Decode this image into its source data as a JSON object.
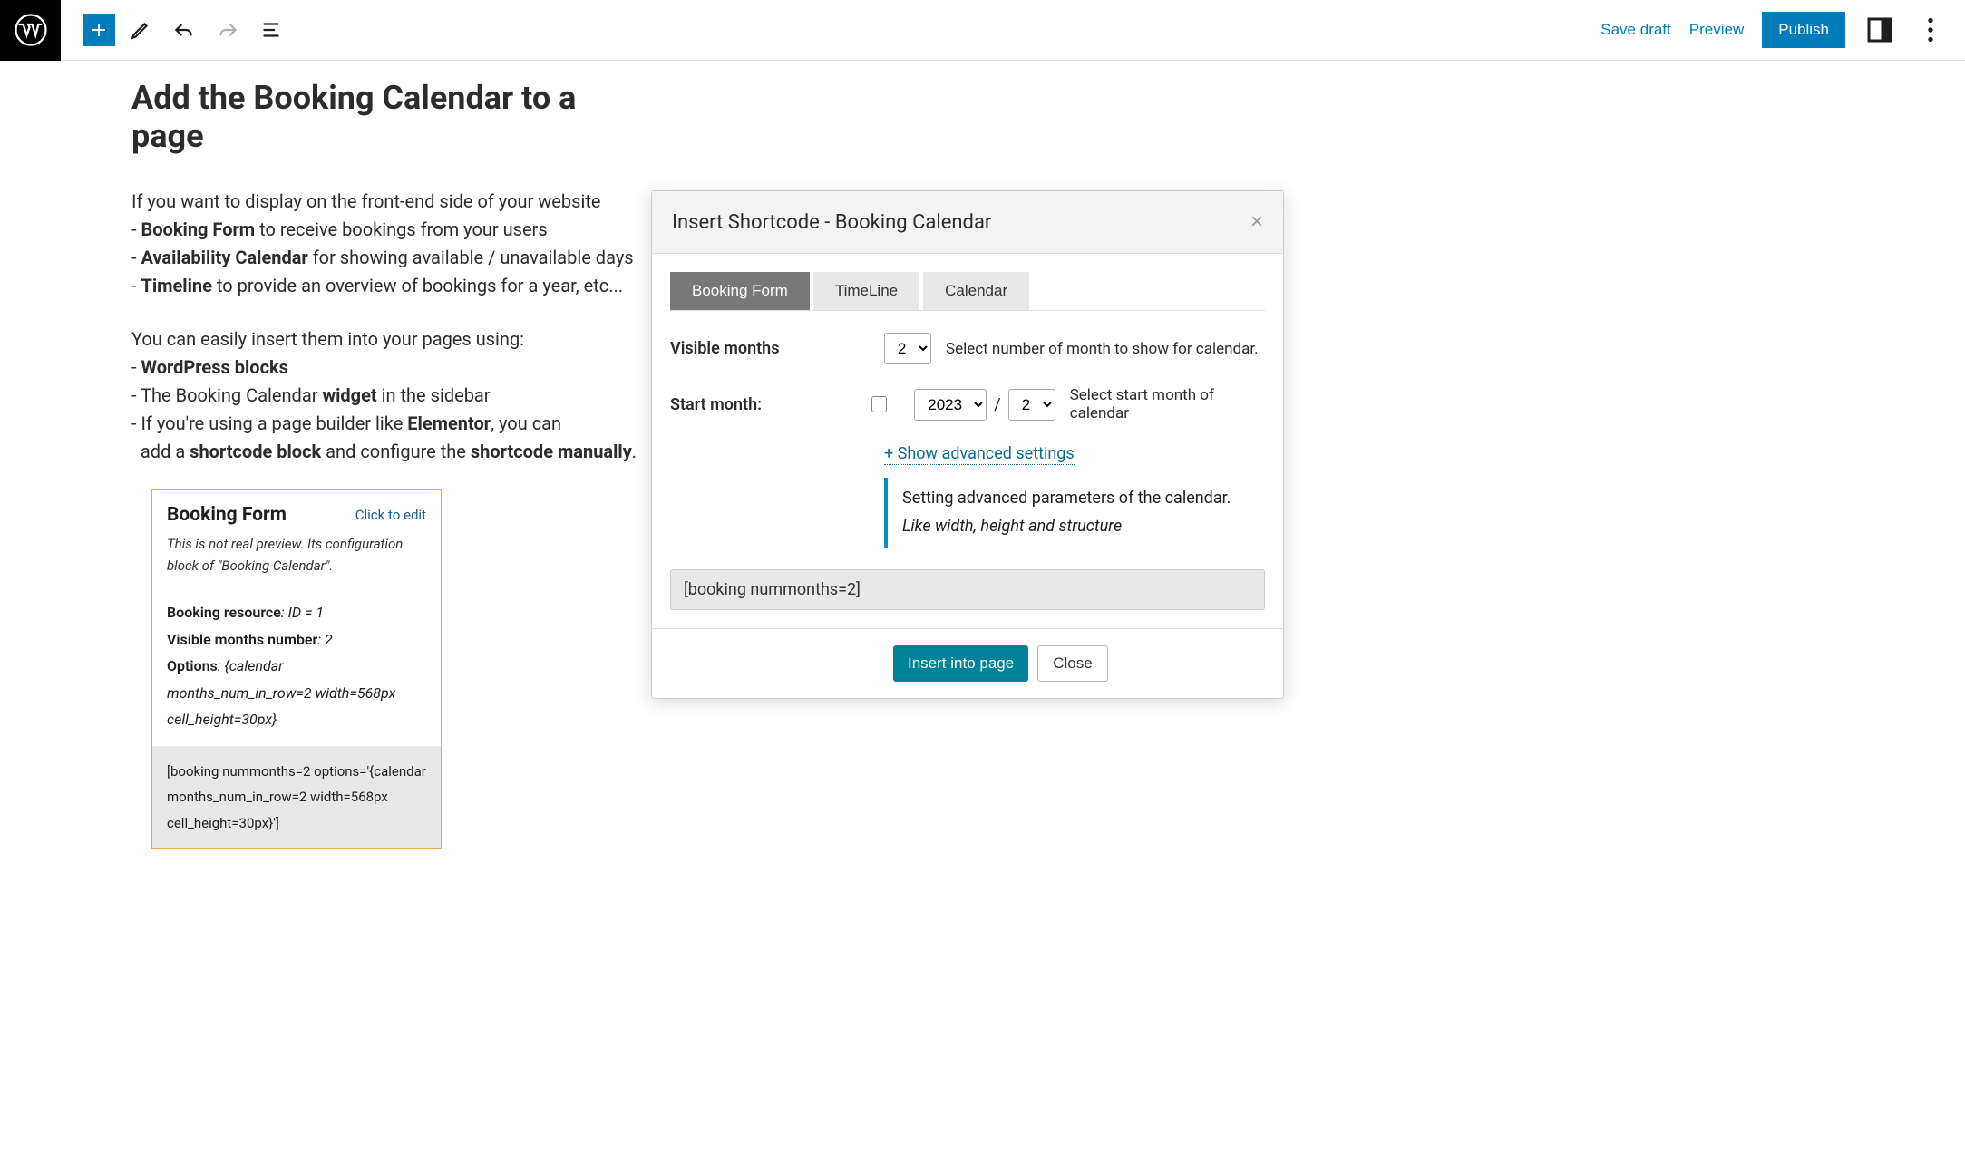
{
  "topbar": {
    "save_draft": "Save draft",
    "preview": "Preview",
    "publish": "Publish"
  },
  "page": {
    "title": "Add the Booking Calendar to a page",
    "intro_line": "If you want to display on the front-end side of your website",
    "bullet1_prefix": "- ",
    "bullet1_bold": "Booking Form",
    "bullet1_rest": " to receive bookings from your users",
    "bullet2_prefix": "- ",
    "bullet2_bold": "Availability Calendar",
    "bullet2_rest": " for showing available / unavailable days",
    "bullet3_prefix": "- ",
    "bullet3_bold": "Timeline",
    "bullet3_rest": " to provide an overview of bookings for a year, etc...",
    "insert_line": "You can easily insert them into your pages using:",
    "ins1_prefix": "- ",
    "ins1_bold": "WordPress blocks",
    "ins2_prefix": "- The Booking Calendar ",
    "ins2_bold": "widget",
    "ins2_rest": " in the sidebar",
    "ins3_prefix": "- If you're using a page builder like ",
    "ins3_bold": "Elementor",
    "ins3_rest": ", you can",
    "ins3_line2_prefix": "  add a ",
    "ins3_line2_bold1": "shortcode block",
    "ins3_line2_mid": " and configure the ",
    "ins3_line2_bold2": "shortcode manually",
    "ins3_line2_end": "."
  },
  "block": {
    "title": "Booking Form",
    "edit": "Click to edit",
    "subtitle": "This is not real preview. Its configuration block of \"Booking Calendar\".",
    "res_label": "Booking resource",
    "res_val": ": ID = 1",
    "months_label": "Visible months number",
    "months_val": ": 2",
    "opts_label": "Options",
    "opts_val": ": {calendar months_num_in_row=2 width=568px cell_height=30px}",
    "code": "[booking nummonths=2 options='{calendar months_num_in_row=2 width=568px cell_height=30px}']"
  },
  "modal": {
    "title": "Insert Shortcode - Booking Calendar",
    "tabs": {
      "t1": "Booking Form",
      "t2": "TimeLine",
      "t3": "Calendar"
    },
    "visible_months_label": "Visible months",
    "visible_months_value": "2",
    "visible_months_help": "Select number of month to show for calendar.",
    "start_month_label": "Start month:",
    "start_year_value": "2023",
    "start_month_value": "2",
    "start_month_help": "Select start month of calendar",
    "adv_link": "+ Show advanced settings",
    "adv_note_l1": "Setting advanced parameters of the calendar.",
    "adv_note_l2": "Like width, height and structure",
    "shortcode": "[booking nummonths=2]",
    "insert_btn": "Insert into page",
    "close_btn": "Close"
  }
}
